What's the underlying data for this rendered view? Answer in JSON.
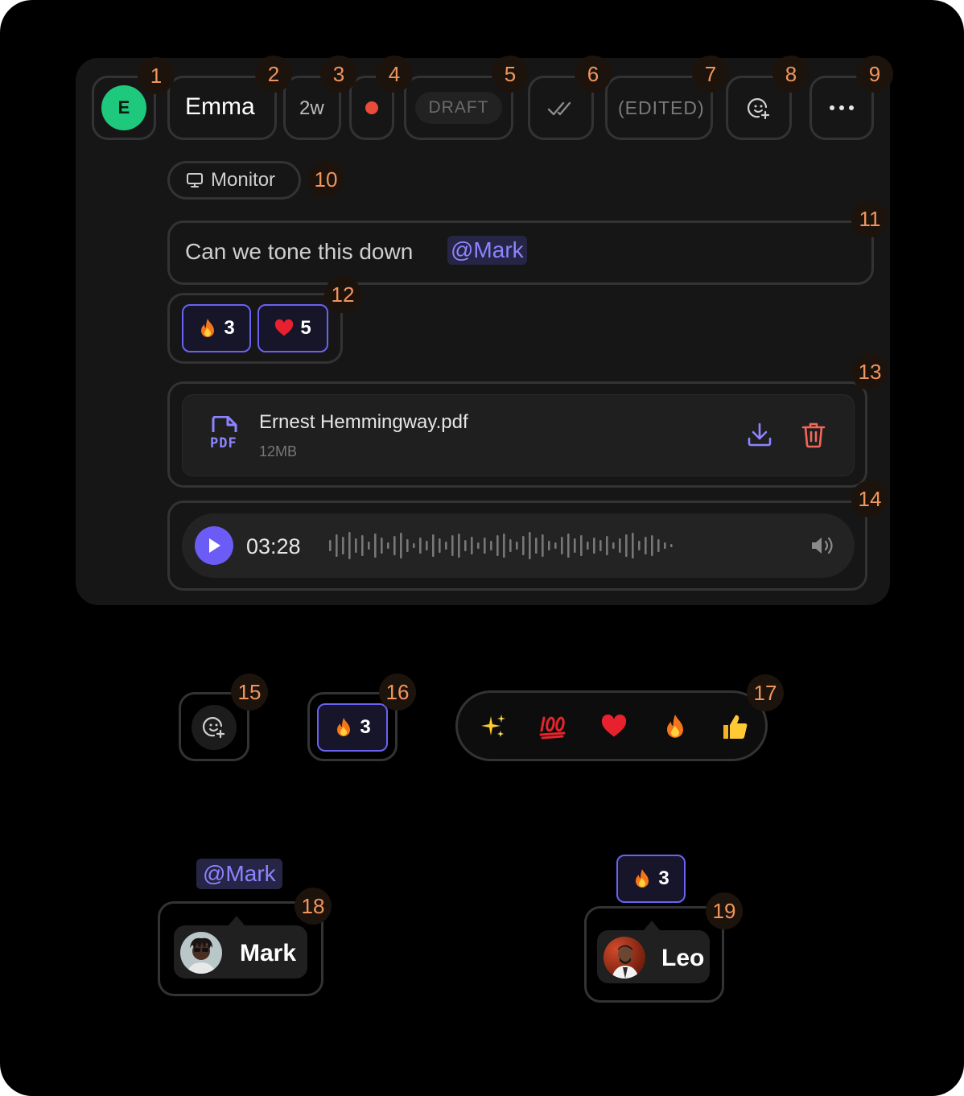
{
  "message": {
    "avatar_initial": "E",
    "author": "Emma",
    "timestamp": "2w",
    "draft_label": "DRAFT",
    "edited_label": "(EDITED)",
    "source_label": "Monitor",
    "text": "Can we tone this down",
    "mention": "@Mark",
    "reactions": [
      {
        "emoji": "fire",
        "count": "3"
      },
      {
        "emoji": "heart",
        "count": "5"
      }
    ],
    "attachment": {
      "name": "Ernest Hemmingway.pdf",
      "size": "12MB",
      "type_label": "PDF"
    },
    "voice_note": {
      "duration": "03:28"
    }
  },
  "standalone_reaction": {
    "emoji": "fire",
    "count": "3"
  },
  "emoji_picker": [
    "sparkles",
    "hundred-points",
    "heart",
    "fire",
    "thumbs-up"
  ],
  "mention_tooltip": {
    "mention": "@Mark",
    "user_name": "Mark"
  },
  "reaction_tooltip": {
    "emoji": "fire",
    "count": "3",
    "user_name": "Leo"
  },
  "annotations": [
    "1",
    "2",
    "3",
    "4",
    "5",
    "6",
    "7",
    "8",
    "9",
    "10",
    "11",
    "12",
    "13",
    "14",
    "15",
    "16",
    "17",
    "18",
    "19"
  ],
  "colors": {
    "accent": "#6b5cf5",
    "mention_text": "#8c84ff",
    "avatar_green": "#1ec97d",
    "unread_dot": "#ea4c3c",
    "delete_red": "#f2675a",
    "annotation_orange": "#f0955d"
  }
}
